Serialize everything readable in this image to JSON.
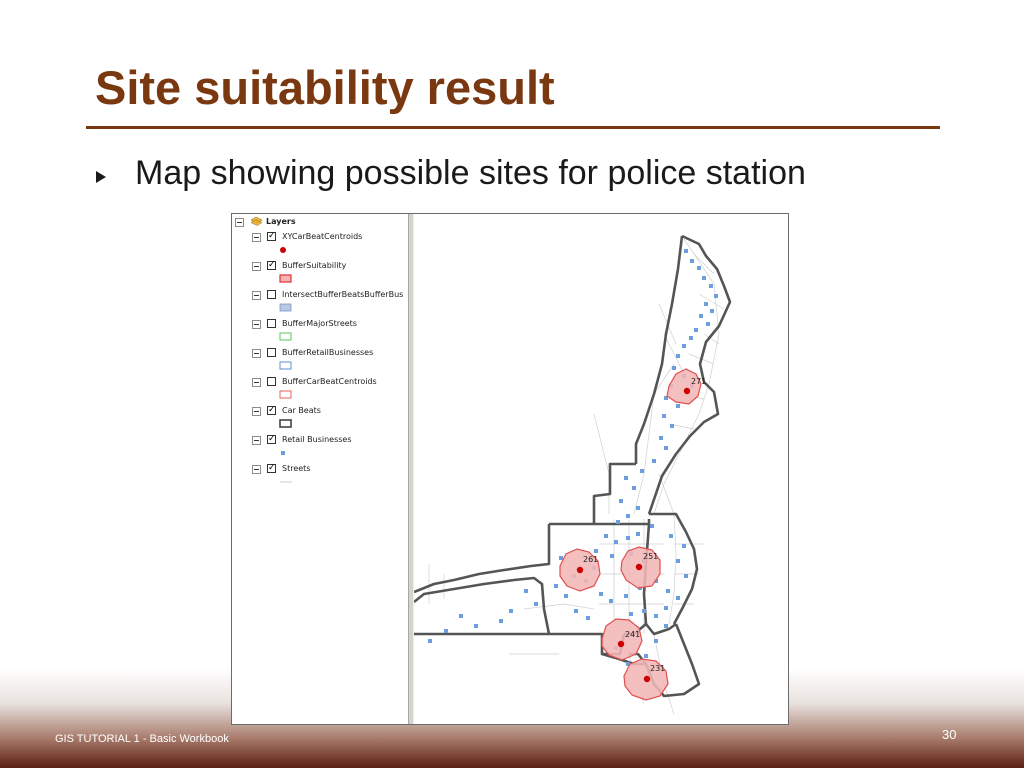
{
  "slide": {
    "title": "Site suitability result",
    "bullet": "Map showing possible sites for police station",
    "footer_left": "GIS TUTORIAL 1 - Basic Workbook",
    "page_number": "30"
  },
  "colors": {
    "title": "#7a3810",
    "footer_gradient_top": "#ffffff",
    "footer_gradient_bottom": "#5c1f10",
    "centroid": "#cc0000",
    "buffer_fill": "#f2b6b6",
    "buffer_stroke": "#e05050",
    "business": "#6c9ee0",
    "beat_outline": "#555555"
  },
  "toc": {
    "root_label": "Layers",
    "layers": [
      {
        "name": "XYCarBeatCentroids",
        "checked": true,
        "symbol": "red-dot"
      },
      {
        "name": "BufferSuitability",
        "checked": true,
        "symbol": "red-filled-rect"
      },
      {
        "name": "IntersectBufferBeatsBufferBus",
        "checked": false,
        "symbol": "blue-filled-rect"
      },
      {
        "name": "BufferMajorStreets",
        "checked": false,
        "symbol": "green-outline-rect"
      },
      {
        "name": "BufferRetailBusinesses",
        "checked": false,
        "symbol": "blue-outline-rect"
      },
      {
        "name": "BufferCarBeatCentroids",
        "checked": false,
        "symbol": "red-outline-rect"
      },
      {
        "name": "Car Beats",
        "checked": true,
        "symbol": "dark-outline-rect"
      },
      {
        "name": "Retail Businesses",
        "checked": true,
        "symbol": "small-blue-square"
      },
      {
        "name": "Streets",
        "checked": true,
        "symbol": "grey-line"
      }
    ]
  },
  "map": {
    "site_labels": [
      "271",
      "261",
      "251",
      "241",
      "231"
    ]
  }
}
